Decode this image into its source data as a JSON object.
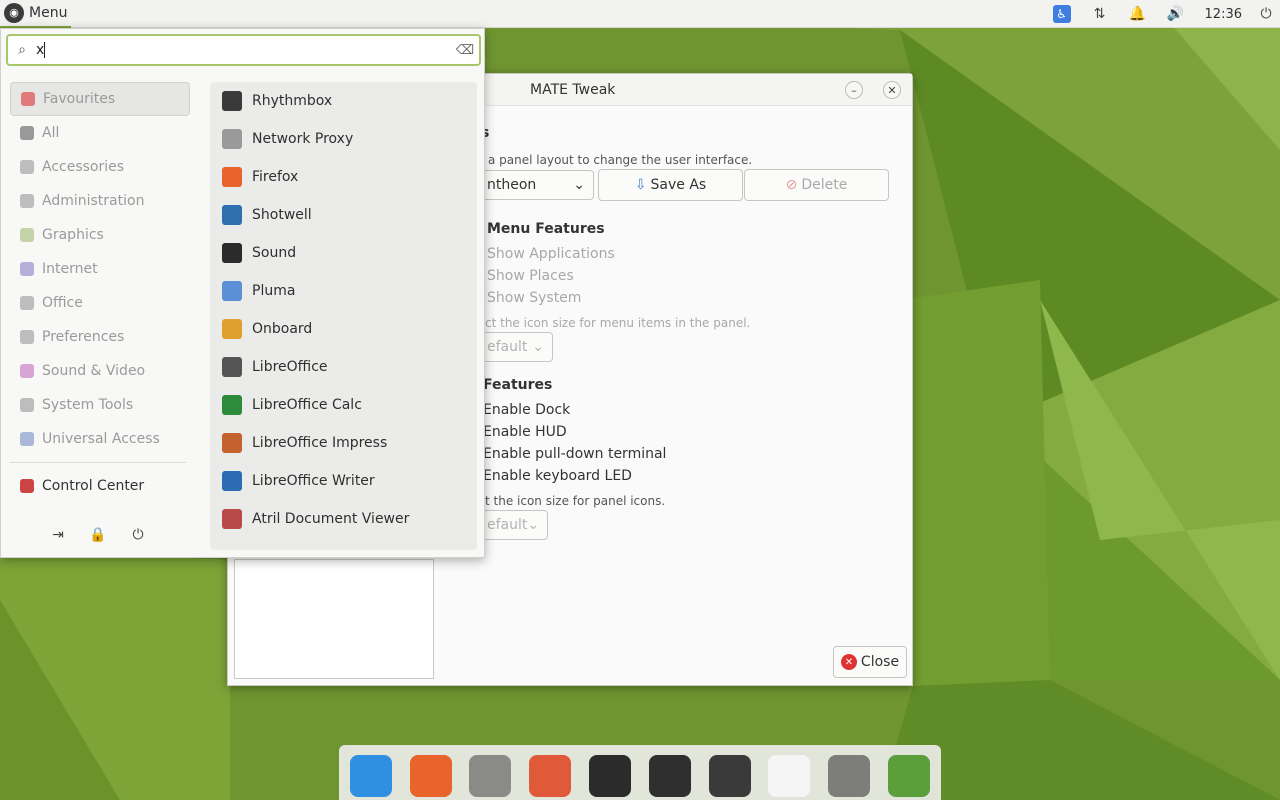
{
  "top_panel": {
    "menu_label": "Menu",
    "clock": "12:36",
    "tray_icons": [
      "accessibility-icon",
      "network-icon",
      "notification-icon",
      "volume-icon",
      "power-icon"
    ]
  },
  "tweak_window": {
    "title": "MATE Tweak",
    "heading_partial": "s",
    "layout_hint": "a panel layout to change the user interface.",
    "layout_value": "ntheon",
    "save_as_label": "Save As",
    "delete_label": "Delete",
    "menu_features_heading": "Menu Features",
    "show_applications": "Show Applications",
    "show_places": "Show Places",
    "show_system": "Show System",
    "menu_icon_hint": "ct the icon size for menu items in the panel.",
    "menu_icon_value": "efault",
    "features_heading": "Features",
    "enable_dock": "Enable Dock",
    "enable_hud": "Enable HUD",
    "enable_terminal": "Enable pull-down terminal",
    "enable_keyboard_led": "Enable keyboard LED",
    "panel_icon_hint": "t the icon size for panel icons.",
    "panel_icon_value": "efault",
    "close_label": "Close"
  },
  "menu": {
    "search": {
      "value": "x"
    },
    "categories": [
      {
        "label": "Favourites",
        "color": "#e07a7a"
      },
      {
        "label": "All",
        "color": "#999999"
      },
      {
        "label": "Accessories",
        "color": "#bdbdbd"
      },
      {
        "label": "Administration",
        "color": "#bdbdbd"
      },
      {
        "label": "Graphics",
        "color": "#c5d3a8"
      },
      {
        "label": "Internet",
        "color": "#b5b0d9"
      },
      {
        "label": "Office",
        "color": "#bdbdbd"
      },
      {
        "label": "Preferences",
        "color": "#bdbdbd"
      },
      {
        "label": "Sound & Video",
        "color": "#d6a5d6"
      },
      {
        "label": "System Tools",
        "color": "#bdbdbd"
      },
      {
        "label": "Universal Access",
        "color": "#a9b8d9"
      }
    ],
    "control_center": "Control Center",
    "apps": [
      {
        "label": "Rhythmbox",
        "icon": "rhythmbox-icon",
        "color": "#3a3a3a"
      },
      {
        "label": "Network Proxy",
        "icon": "network-proxy-icon",
        "color": "#9a9a9a"
      },
      {
        "label": "Firefox",
        "icon": "firefox-icon",
        "color": "#e8642b"
      },
      {
        "label": "Shotwell",
        "icon": "shotwell-icon",
        "color": "#2f6fb0"
      },
      {
        "label": "Sound",
        "icon": "sound-icon",
        "color": "#2b2b2b"
      },
      {
        "label": "Pluma",
        "icon": "pluma-icon",
        "color": "#5b8fd6"
      },
      {
        "label": "Onboard",
        "icon": "onboard-icon",
        "color": "#e0a030"
      },
      {
        "label": "LibreOffice",
        "icon": "libreoffice-icon",
        "color": "#555555"
      },
      {
        "label": "LibreOffice Calc",
        "icon": "libreoffice-calc-icon",
        "color": "#2e8b3b"
      },
      {
        "label": "LibreOffice Impress",
        "icon": "libreoffice-impress-icon",
        "color": "#c4622d"
      },
      {
        "label": "LibreOffice Writer",
        "icon": "libreoffice-writer-icon",
        "color": "#2b6cb5"
      },
      {
        "label": "Atril Document Viewer",
        "icon": "atril-icon",
        "color": "#b94a48"
      }
    ]
  },
  "dock": {
    "items": [
      {
        "name": "file-manager-window-icon",
        "color": "#2f8fe0"
      },
      {
        "name": "firefox-icon",
        "color": "#e8642b"
      },
      {
        "name": "files-icon",
        "color": "#8a8a86"
      },
      {
        "name": "toggle-settings-icon",
        "color": "#e05a3a"
      },
      {
        "name": "system-monitor-icon",
        "color": "#2b2b2b"
      },
      {
        "name": "terminal-icon",
        "color": "#2f2f2f"
      },
      {
        "name": "calculator-icon",
        "color": "#3a3a3a"
      },
      {
        "name": "clock-icon",
        "color": "#f5f5f5"
      },
      {
        "name": "trash-icon",
        "color": "#7d7d79"
      },
      {
        "name": "tweak-icon",
        "color": "#5a9f3a"
      }
    ]
  }
}
